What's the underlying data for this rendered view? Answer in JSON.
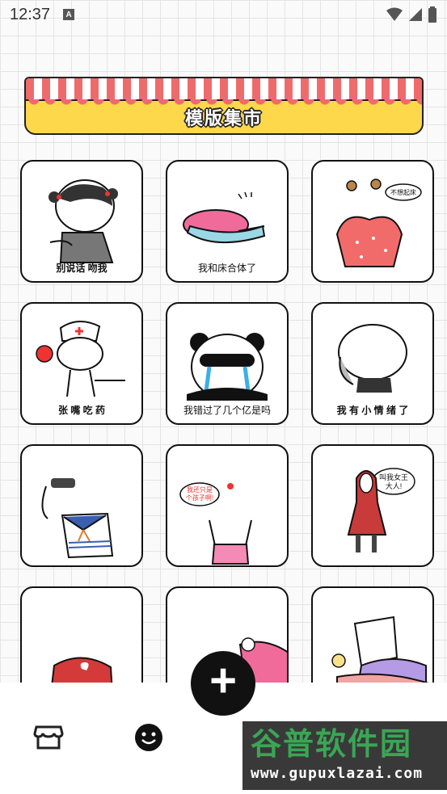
{
  "status_bar": {
    "time": "12:37",
    "notification_glyph": "A"
  },
  "banner": {
    "title": "模版集市"
  },
  "templates": [
    {
      "caption": "别说话 吻我"
    },
    {
      "caption": "我和床合体了"
    },
    {
      "caption": "",
      "bubble": "不想起床"
    },
    {
      "caption": "张 嘴 吃 药"
    },
    {
      "caption": "我错过了几个亿是吗"
    },
    {
      "caption": "我 有 小 情 绪 了"
    },
    {
      "caption": ""
    },
    {
      "caption": "",
      "bubble_line1": "我还只是",
      "bubble_line2": "个孩子啊!"
    },
    {
      "caption": "",
      "bubble_line1": "叫我女王",
      "bubble_line2": "大人!"
    },
    {
      "caption": ""
    },
    {
      "caption": ""
    },
    {
      "caption": ""
    }
  ],
  "nav": {
    "store_icon": "store-icon",
    "emoji_icon": "smiley-icon",
    "fab_label": "+"
  },
  "watermark": {
    "title": "谷普软件园",
    "url": "www.gupuxlazai.com"
  },
  "colors": {
    "banner_yellow": "#fdd84a",
    "stripe_red": "#ef6b6b",
    "fab": "#111111",
    "watermark_green": "#3aa655"
  }
}
